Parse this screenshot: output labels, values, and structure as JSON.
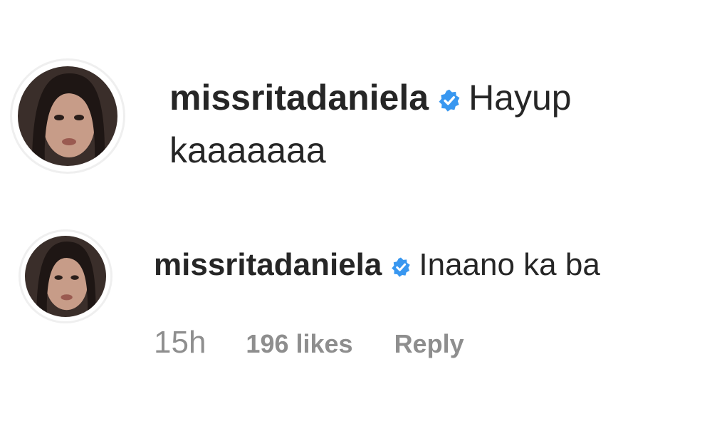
{
  "comments": [
    {
      "username": "missritadaniela",
      "verified_icon": "verified-badge-icon",
      "text": "Hayup kaaaaaaa"
    },
    {
      "username": "missritadaniela",
      "verified_icon": "verified-badge-icon",
      "text": "Inaano ka ba",
      "time": "15h",
      "likes": "196 likes",
      "reply_label": "Reply"
    }
  ],
  "colors": {
    "text": "#262626",
    "meta": "#8e8e8e",
    "verified": "#3897f0",
    "avatar_ring": "#efefef"
  }
}
